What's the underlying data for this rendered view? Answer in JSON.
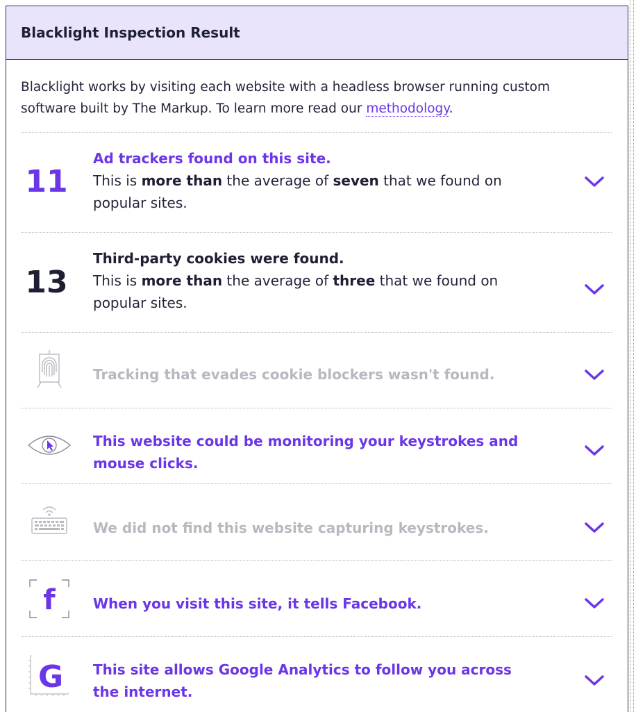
{
  "header": {
    "title": "Blacklight Inspection Result"
  },
  "intro": {
    "text": "Blacklight works by visiting each website with a headless browser running custom software built by The Markup. To learn more read our ",
    "link": "methodology",
    "period": "."
  },
  "rows": [
    {
      "count": "11",
      "headline": "Ad trackers found on this site.",
      "body_pre": "This is ",
      "body_b1": "more than",
      "body_mid": " the average of ",
      "body_b2": "seven",
      "body_post": " that we found on popular sites."
    },
    {
      "count": "13",
      "headline": "Third-party cookies were found.",
      "body_pre": "This is ",
      "body_b1": "more than",
      "body_mid": " the average of ",
      "body_b2": "three",
      "body_post": " that we found on popular sites."
    },
    {
      "icon": "fingerprint-icon",
      "headline": "Tracking that evades cookie blockers wasn't found."
    },
    {
      "icon": "eye-cursor-icon",
      "headline": "This website could be monitoring your keystrokes and mouse clicks."
    },
    {
      "icon": "keyboard-icon",
      "headline": "We did not find this website capturing keystrokes."
    },
    {
      "icon": "facebook-icon",
      "headline": "When you visit this site, it tells Facebook."
    },
    {
      "icon": "google-icon",
      "headline": "This site allows Google Analytics to follow you across the internet."
    }
  ],
  "colors": {
    "accent": "#6b35e8",
    "header_bg": "#e9e4fc",
    "muted": "#b8b8c0",
    "dark": "#1f1f33"
  }
}
